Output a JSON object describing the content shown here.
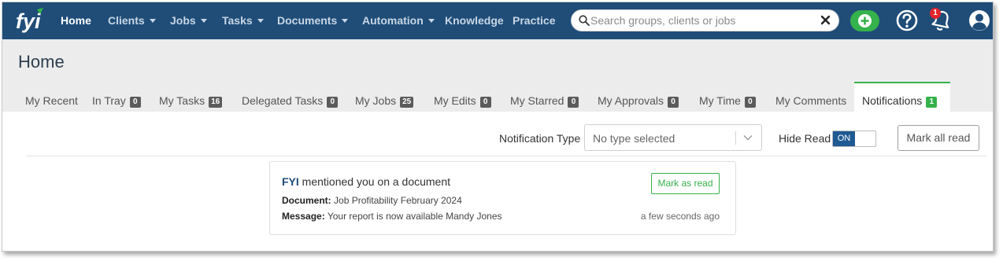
{
  "nav": {
    "logo_text": "fyi",
    "items": [
      {
        "label": "Home",
        "active": true,
        "dropdown": false
      },
      {
        "label": "Clients",
        "active": false,
        "dropdown": true
      },
      {
        "label": "Jobs",
        "active": false,
        "dropdown": true
      },
      {
        "label": "Tasks",
        "active": false,
        "dropdown": true
      },
      {
        "label": "Documents",
        "active": false,
        "dropdown": true
      },
      {
        "label": "Automation",
        "active": false,
        "dropdown": true
      },
      {
        "label": "Knowledge",
        "active": false,
        "dropdown": false
      },
      {
        "label": "Practice",
        "active": false,
        "dropdown": false
      }
    ],
    "search_placeholder": "Search groups, clients or jobs",
    "notification_count": "1",
    "icons": [
      "search-icon",
      "close-icon",
      "plus-icon",
      "help-icon",
      "bell-icon",
      "user-icon"
    ]
  },
  "page": {
    "title": "Home",
    "tabs": [
      {
        "label": "My Recent",
        "count": null
      },
      {
        "label": "In Tray",
        "count": "0"
      },
      {
        "label": "My Tasks",
        "count": "16"
      },
      {
        "label": "Delegated Tasks",
        "count": "0"
      },
      {
        "label": "My Jobs",
        "count": "25"
      },
      {
        "label": "My Edits",
        "count": "0"
      },
      {
        "label": "My Starred",
        "count": "0"
      },
      {
        "label": "My Approvals",
        "count": "0"
      },
      {
        "label": "My Time",
        "count": "0"
      },
      {
        "label": "My Comments",
        "count": null
      }
    ],
    "active_tab": {
      "label": "Notifications",
      "count": "1"
    }
  },
  "filters": {
    "notification_type_label": "Notification Type",
    "notification_type_value": "No type selected",
    "hide_read_label": "Hide Read",
    "hide_read_state": "ON",
    "mark_all_label": "Mark all read"
  },
  "notification": {
    "sender": "FYI",
    "headline": "mentioned you on a document",
    "document_label": "Document:",
    "document_value": "Job Profitability February 2024",
    "message_label": "Message:",
    "message_value": "Your report is now available Mandy Jones",
    "mark_read_label": "Mark as read",
    "time": "a few seconds ago"
  },
  "colors": {
    "nav_bg": "#1f4d78",
    "accent_green": "#35b24b",
    "badge_red": "#e3242b",
    "toggle_blue": "#1f5a93",
    "header_bg": "#ececec"
  }
}
